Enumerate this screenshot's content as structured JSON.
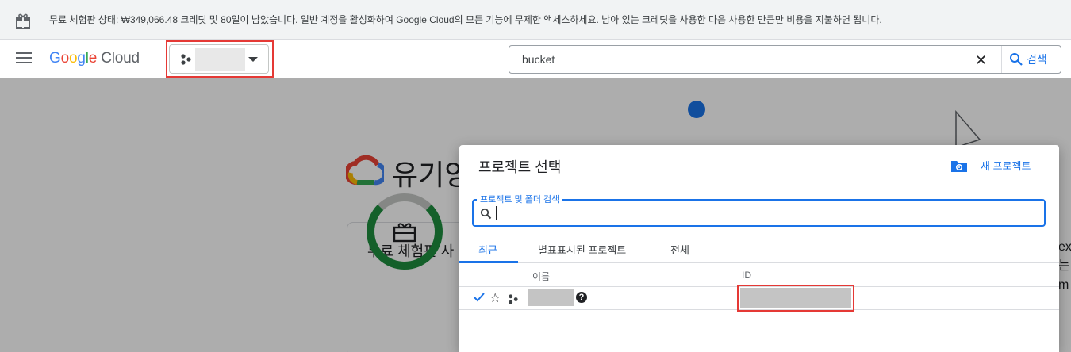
{
  "banner": {
    "text": "무료 체험판 상태: ₩349,066.48 크레딧 및 80일이 남았습니다. 일반 계정을 활성화하여 Google Cloud의 모든 기능에 무제한 액세스하세요. 남아 있는 크레딧을 사용한 다음 사용한 만큼만 비용을 지불하면 됩니다."
  },
  "header": {
    "logo_google": [
      "G",
      "o",
      "o",
      "g",
      "l",
      "e"
    ],
    "logo_cloud": "Cloud",
    "search_value": "bucket",
    "search_button_label": "검색",
    "clear_glyph": "✕"
  },
  "background": {
    "welcome_title": "유기양",
    "card_title": "무료 체험판 사",
    "right_peek": [
      "ex",
      "는",
      "",
      "m"
    ]
  },
  "dialog": {
    "title": "프로젝트 선택",
    "new_project_label": "새 프로젝트",
    "search_label": "프로젝트 및 폴더 검색",
    "search_value": "",
    "tabs": [
      "최근",
      "별표표시된 프로젝트",
      "전체"
    ],
    "active_tab": 0,
    "columns": {
      "name": "이름",
      "id": "ID"
    },
    "rows": [
      {
        "selected": true,
        "starred": false,
        "name": "",
        "id": ""
      }
    ]
  },
  "colors": {
    "accent": "#1a73e8",
    "highlight_box": "#e53935",
    "ring": "#1e8e3e"
  },
  "icons": {
    "banner": "gift-icon",
    "menu": "hamburger-menu-icon",
    "project": "project-dots-icon",
    "search": "search-icon",
    "new_project": "folder-gear-icon",
    "check": "check-icon",
    "star": "star-outline-icon",
    "help": "help-circle-icon"
  }
}
